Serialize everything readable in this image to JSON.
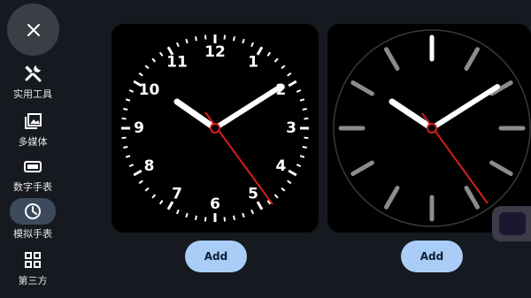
{
  "nav": {
    "items": [
      {
        "label": "实用工具",
        "icon": "tools-icon"
      },
      {
        "label": "多媒体",
        "icon": "gallery-icon"
      },
      {
        "label": "数字手表",
        "icon": "digital-watch-icon"
      },
      {
        "label": "模拟手表",
        "icon": "analog-clock-icon",
        "active": true
      },
      {
        "label": "第三方",
        "icon": "grid-icon"
      }
    ]
  },
  "faces": [
    {
      "numerals": [
        "12",
        "1",
        "2",
        "3",
        "4",
        "5",
        "6",
        "7",
        "8",
        "9",
        "10",
        "11"
      ],
      "add_label": "Add"
    },
    {
      "add_label": "Add"
    }
  ],
  "colors": {
    "background": "#16191f",
    "card": "#000000",
    "add_button": "#a9cdf6",
    "second_hand": "#d61f1f",
    "nav_active": "#3d4a5c"
  }
}
